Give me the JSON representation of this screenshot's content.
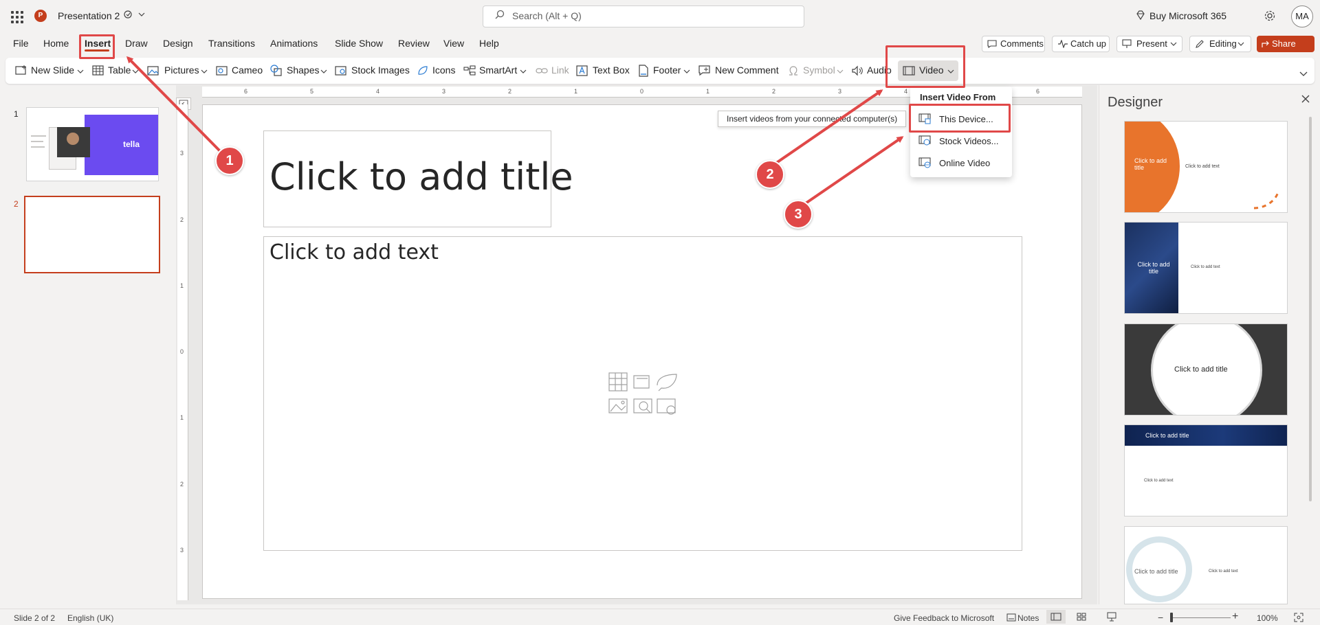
{
  "titlebar": {
    "app_logo": "P",
    "doc_title": "Presentation 2",
    "search_placeholder": "Search (Alt + Q)",
    "buy": "Buy Microsoft 365",
    "avatar": "MA"
  },
  "menu": {
    "tabs": [
      "File",
      "Home",
      "Insert",
      "Draw",
      "Design",
      "Transitions",
      "Animations",
      "Slide Show",
      "Review",
      "View",
      "Help"
    ],
    "active_tab": "Insert",
    "comments": "Comments",
    "catchup": "Catch up",
    "present": "Present",
    "editing": "Editing",
    "share": "Share"
  },
  "ribbon": {
    "new_slide": "New Slide",
    "table": "Table",
    "pictures": "Pictures",
    "cameo": "Cameo",
    "shapes": "Shapes",
    "stock_images": "Stock Images",
    "icons": "Icons",
    "smartart": "SmartArt",
    "link": "Link",
    "text_box": "Text Box",
    "footer": "Footer",
    "new_comment": "New Comment",
    "symbol": "Symbol",
    "audio": "Audio",
    "video": "Video"
  },
  "video_menu": {
    "header": "Insert Video From",
    "items": [
      "This Device...",
      "Stock Videos...",
      "Online Video"
    ],
    "tooltip": "Insert videos from your connected computer(s)"
  },
  "ruler": {
    "h_ticks": [
      "6",
      "5",
      "4",
      "3",
      "2",
      "1",
      "0",
      "1",
      "2",
      "3",
      "4",
      "5",
      "6"
    ],
    "v_ticks": [
      "3",
      "2",
      "1",
      "0",
      "1",
      "2",
      "3"
    ]
  },
  "slides_panel": {
    "slides": [
      {
        "number": "1",
        "brand": "tella"
      },
      {
        "number": "2"
      }
    ]
  },
  "slide": {
    "title_placeholder": "Click to add title",
    "body_placeholder": "Click to add text"
  },
  "designer": {
    "title": "Designer",
    "cards": [
      {
        "title": "Click to add title",
        "text": "Click to add text"
      },
      {
        "title": "Click to add title",
        "text": "Click to add text"
      },
      {
        "title": "Click to add title"
      },
      {
        "title": "Click to add title",
        "text": "Click to add text"
      },
      {
        "title": "Click to add title",
        "text": "Click to add text"
      }
    ]
  },
  "status": {
    "slide_count": "Slide 2 of 2",
    "language": "English (UK)",
    "feedback": "Give Feedback to Microsoft",
    "notes": "Notes",
    "zoom": "100%"
  },
  "annotations": {
    "badges": [
      "1",
      "2",
      "3"
    ]
  },
  "colors": {
    "accent": "#c43e1c",
    "annotation": "#e04848",
    "slide_bg": "#ffffff",
    "thumb_purple": "#6b4bf0",
    "design_orange": "#e8742c"
  }
}
